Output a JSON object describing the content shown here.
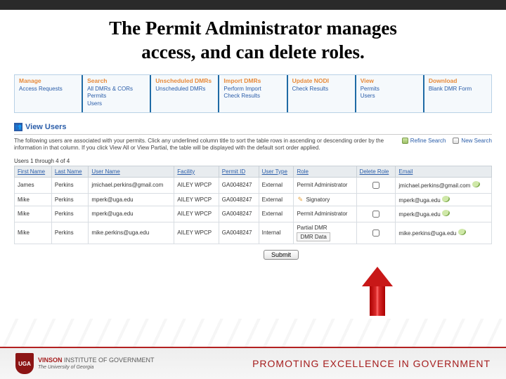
{
  "slide_title_line1": "The Permit Administrator manages",
  "slide_title_line2": "access, and can delete roles.",
  "nav": [
    {
      "title": "Manage",
      "links": [
        "Access Requests"
      ]
    },
    {
      "title": "Search",
      "links": [
        "All DMRs & CORs",
        "Permits",
        "Users"
      ]
    },
    {
      "title": "Unscheduled DMRs",
      "links": [
        "Unscheduled DMRs"
      ]
    },
    {
      "title": "Import DMRs",
      "links": [
        "Perform Import",
        "Check Results"
      ]
    },
    {
      "title": "Update NODI",
      "links": [
        "Check Results"
      ]
    },
    {
      "title": "View",
      "links": [
        "Permits",
        "Users"
      ]
    },
    {
      "title": "Download",
      "links": [
        "Blank DMR Form"
      ]
    }
  ],
  "section": {
    "title": "View Users"
  },
  "help_text": "The following users are associated with your permits. Click any underlined column title to sort the table rows in ascending or descending order by the information in that column. If you click View All or View Partial, the table will be displayed with the default sort order applied.",
  "help_links": {
    "refine": "Refine Search",
    "new": "New Search"
  },
  "count_text": "Users 1 through 4 of 4",
  "table": {
    "headers": [
      "First Name",
      "Last Name",
      "User Name",
      "Facility",
      "Permit ID",
      "User Type",
      "Role",
      "Delete Role",
      "Email"
    ],
    "rows": [
      {
        "first": "James",
        "last": "Perkins",
        "user": "jmichael.perkins@gmail.com",
        "facility": "AILEY WPCP",
        "permit": "GA0048247",
        "usertype": "External",
        "role": "Permit Administrator",
        "role_pencil": false,
        "delete_checkbox": true,
        "email": "jmichael.perkins@gmail.com"
      },
      {
        "first": "Mike",
        "last": "Perkins",
        "user": "mperk@uga.edu",
        "facility": "AILEY WPCP",
        "permit": "GA0048247",
        "usertype": "External",
        "role": "Signatory",
        "role_pencil": true,
        "delete_checkbox": false,
        "email": "mperk@uga.edu"
      },
      {
        "first": "Mike",
        "last": "Perkins",
        "user": "mperk@uga.edu",
        "facility": "AILEY WPCP",
        "permit": "GA0048247",
        "usertype": "External",
        "role": "Permit Administrator",
        "role_pencil": false,
        "delete_checkbox": true,
        "email": "mperk@uga.edu"
      },
      {
        "first": "Mike",
        "last": "Perkins",
        "user": "mike.perkins@uga.edu",
        "facility": "AILEY WPCP",
        "permit": "GA0048247",
        "usertype": "Internal",
        "role": "Partial DMR",
        "role_pencil": false,
        "role_extra": "DMR Data",
        "delete_checkbox": true,
        "email": "mike.perkins@uga.edu"
      }
    ]
  },
  "submit_label": "Submit",
  "footer": {
    "logo_line1": "VINSON",
    "logo_line2": "INSTITUTE OF GOVERNMENT",
    "logo_line3": "The University of Georgia",
    "tagline": "PROMOTING EXCELLENCE IN GOVERNMENT"
  }
}
